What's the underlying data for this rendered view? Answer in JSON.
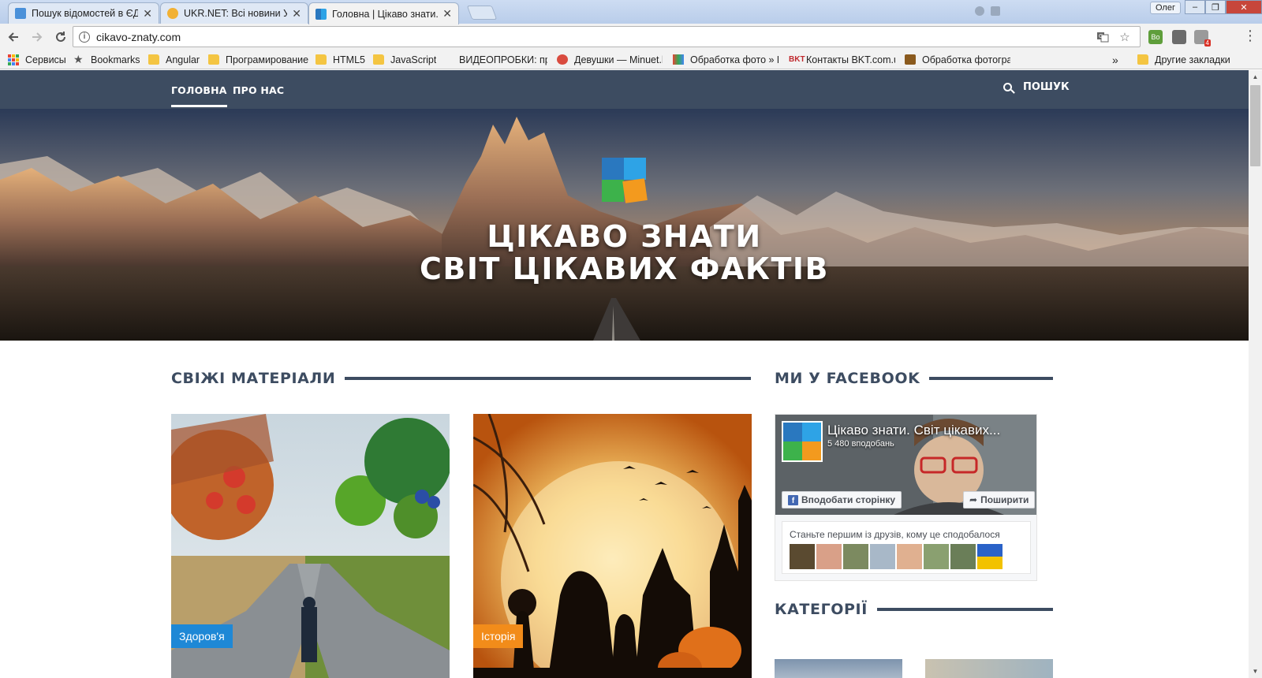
{
  "browser": {
    "tabs": [
      {
        "title": "Пошук відомостей в ЄДР",
        "favicon_color": "#4a90d9",
        "active": false
      },
      {
        "title": "UKR.NET: Всі новини України",
        "favicon_color": "#f2b134",
        "active": false
      },
      {
        "title": "Головна | Цікаво знати. Світ",
        "favicon_color": "#2e8bd3",
        "active": true
      }
    ],
    "tab_close": "✕",
    "profile_name": "Олег",
    "window_buttons": {
      "minimize": "–",
      "restore": "❐",
      "close": "✕"
    },
    "url": "cikavo-znaty.com",
    "extensions": [
      {
        "label": "Bo",
        "color": "#5f9e3b"
      },
      {
        "label": "",
        "color": "#6b6b6b"
      },
      {
        "label": "",
        "color": "#8a8a8a",
        "badge": "4"
      }
    ],
    "bookmarks": [
      {
        "label": "Сервисы",
        "icon": "apps-grid"
      },
      {
        "label": "Bookmarks",
        "icon": "star"
      },
      {
        "label": "Angular",
        "icon": "folder"
      },
      {
        "label": "Програмирование",
        "icon": "folder"
      },
      {
        "label": "HTML5",
        "icon": "folder"
      },
      {
        "label": "JavaScript",
        "icon": "folder"
      },
      {
        "label": "ВИДЕОПРОБКИ: про",
        "icon": "none"
      },
      {
        "label": "Девушки — Minuet.l",
        "icon": "site"
      },
      {
        "label": "Обработка фото » Р",
        "icon": "site"
      },
      {
        "label": "Контакты BKT.com.ua",
        "icon": "bkt"
      },
      {
        "label": "Обработка фотограф",
        "icon": "site"
      }
    ],
    "bookmarks_overflow": "»",
    "other_bookmarks": "Другие закладки"
  },
  "site": {
    "nav": {
      "home": "ГОЛОВНА",
      "about": "ПРО НАС",
      "search": "ПОШУК"
    },
    "hero": {
      "title_line1": "ЦІКАВО ЗНАТИ",
      "title_line2": "СВІТ ЦІКАВИХ ФАКТІВ"
    },
    "logo_colors": {
      "top_left": "#2a78bf",
      "top_right": "#2ea3e6",
      "bottom_left": "#3db24b",
      "bottom_right": "#f39a1e"
    },
    "fresh": {
      "heading": "СВІЖІ МАТЕРІАЛИ",
      "cards": [
        {
          "category": "Здоров'я",
          "badge_color": "#1e88d6"
        },
        {
          "category": "Історія",
          "badge_color": "#f28c1a"
        }
      ]
    },
    "facebook": {
      "heading": "МИ У FACEBOOK",
      "page_name": "Цікаво знати. Світ цікавих...",
      "likes": "5 480 вподобань",
      "like_button": "Вподобати сторінку",
      "share_button": "Поширити",
      "friends_text": "Станьте першим із друзів, кому це сподобалося"
    },
    "categories": {
      "heading": "КАТЕГОРІЇ"
    }
  }
}
